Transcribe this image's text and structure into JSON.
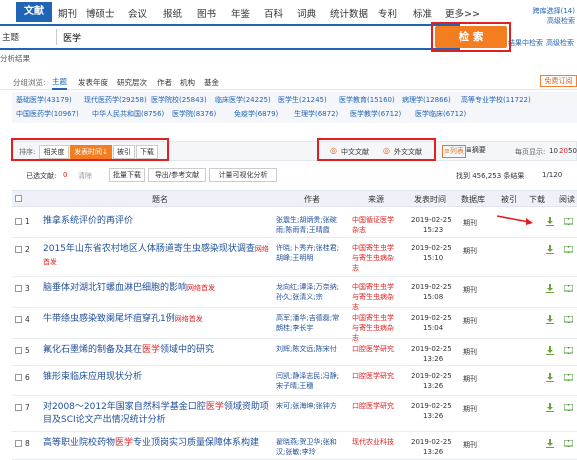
{
  "nav": {
    "active": "文献",
    "items": [
      "期刊",
      "博硕士",
      "会议",
      "报纸",
      "图书",
      "年鉴",
      "百科",
      "词典",
      "统计数据",
      "专利",
      "标准",
      "更多>>"
    ],
    "top_links": [
      "跨库选择(14)",
      "高级检索"
    ],
    "result_links": [
      "结果中检索",
      "高级检索"
    ]
  },
  "search": {
    "field": "主题",
    "value": "医学",
    "button": "检 索",
    "analyze": "分析结果"
  },
  "tabs": {
    "label": "分组浏览:",
    "items": [
      "主题",
      "发表年度",
      "研究层次",
      "作者",
      "机构",
      "基金"
    ],
    "free": "免费订阅"
  },
  "subjects": [
    [
      "基础医学(43179)",
      "现代医药学(29258)",
      "医学院校(25843)",
      "临床医学(24225)",
      "医学生(21245)",
      "医学教育(15160)",
      "病理学(12866)",
      "高等专业学校(11722)"
    ],
    [
      "中国医药学(10967)",
      "中华人民共和国(8756)",
      "医学院(8376)",
      "免疫学(6879)",
      "生理学(6872)",
      "医学教学(6712)",
      "医学临床(6712)"
    ]
  ],
  "sort": {
    "label": "排序:",
    "buttons": [
      "相关度",
      "发表时间",
      "被引",
      "下载"
    ],
    "lang_buttons": [
      "中文文献",
      "外文文献"
    ],
    "view_buttons": [
      "列表",
      "摘要"
    ],
    "per_page_label": "每页显示:",
    "per_page": [
      "10",
      "20",
      "50"
    ]
  },
  "toolbar": {
    "selected_label": "已选文献:",
    "selected_count": "0",
    "clear": "清除",
    "buttons": [
      "批量下载",
      "导出/参考文献",
      "计量可视化分析"
    ],
    "found": "找到 456,253 条结果",
    "page": "1/120"
  },
  "table": {
    "headers": [
      "题名",
      "作者",
      "来源",
      "发表时间",
      "数据库",
      "被引",
      "下载",
      "阅读"
    ],
    "rows": [
      {
        "num": "1",
        "title": "推拿系统评价的再评价",
        "title_hl": "",
        "title_end": "",
        "tag": "",
        "author": "张震生;胡炳贵;张碗雨;陈雨青;王晴霞",
        "source": "中国循证医学杂志",
        "date": "2019-02-25",
        "time": "15:23",
        "db": "期刊"
      },
      {
        "num": "2",
        "title": "2015年山东省农村地区人体肠道寄生虫感染现状调查",
        "title_hl": "",
        "title_end": "",
        "tag": "网络首发",
        "author": "许晓;卜秀卉;张桂君;胡峰;王明明",
        "source": "中国寄生虫学与寄生虫病杂志",
        "date": "2019-02-25",
        "time": "15:10",
        "db": "期刊"
      },
      {
        "num": "3",
        "title": "脑垂体对湖北钉螺血淋巴细胞的影响",
        "title_hl": "",
        "title_end": "",
        "tag": "网络首发",
        "author": "龙向红;谭泽;万奈纳;孙久;张清义;宗",
        "source": "中国寄生虫学与寄生虫病杂志",
        "date": "2019-02-25",
        "time": "15:08",
        "db": "期刊"
      },
      {
        "num": "4",
        "title": "牛带绦虫感染致阑尾坏疽穿孔1例",
        "title_hl": "",
        "title_end": "",
        "tag": "网络首发",
        "author": "高军;潘华;吉德磊;常朗桂;李长宇",
        "source": "中国寄生虫学与寄生虫病杂志",
        "date": "2019-02-25",
        "time": "15:04",
        "db": "期刊"
      },
      {
        "num": "5",
        "title": "氟化石墨烯的制备及其在",
        "title_hl": "医学",
        "title_end": "领域中的研究",
        "tag": "",
        "author": "刘辉;陈文远;陈宋付",
        "source": "口腔医学研究",
        "date": "2019-02-25",
        "time": "13:26",
        "db": "期刊"
      },
      {
        "num": "6",
        "title": "锥形束临床应用现状分析",
        "title_hl": "",
        "title_end": "",
        "tag": "",
        "author": "闫凯;静泽志民;冯静;宋子晴;王穗",
        "source": "口腔医学研究",
        "date": "2019-02-25",
        "time": "13:26",
        "db": "期刊"
      },
      {
        "num": "7",
        "title": "对2008～2012年国家自然科学基金口腔",
        "title_hl": "医学",
        "title_end": "领域资助项目及SCI论文产出情况统计分析",
        "tag": "",
        "author": "宋可;张海坤;张钟方",
        "source": "口腔医学研究",
        "date": "2019-02-25",
        "time": "13:26",
        "db": "期刊"
      },
      {
        "num": "8",
        "title": "高等职业院校药物",
        "title_hl": "医学",
        "title_end": "专业顶岗实习质量保障体系构建",
        "tag": "",
        "author": "翟晓燕;贺卫华;张和汉;张敏;李玲",
        "source": "现代农业科技",
        "date": "2019-02-25",
        "time": "13:26",
        "db": "期刊"
      }
    ]
  },
  "colors": {
    "brand": "#1f64b5",
    "accent": "#f47d20",
    "highlight": "#e02020",
    "download": "#7cb342",
    "read": "#4caf50"
  }
}
